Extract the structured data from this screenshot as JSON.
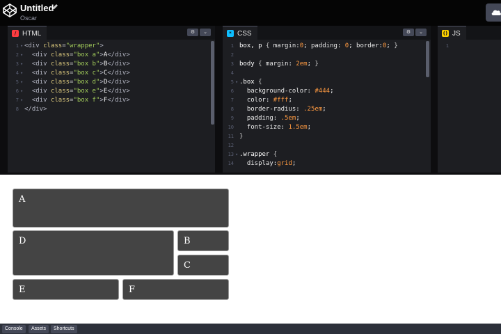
{
  "header": {
    "title": "Untitled",
    "author": "Oscar"
  },
  "editors": {
    "html": {
      "label": "HTML",
      "icon_color": "#ff3c41",
      "lines": [
        {
          "n": "1",
          "text": "<div class=\"wrapper\">"
        },
        {
          "n": "2",
          "text": "  <div class=\"box a\">A</div>"
        },
        {
          "n": "3",
          "text": "  <div class=\"box b\">B</div>"
        },
        {
          "n": "4",
          "text": "  <div class=\"box c\">C</div>"
        },
        {
          "n": "5",
          "text": "  <div class=\"box d\">D</div>"
        },
        {
          "n": "6",
          "text": "  <div class=\"box e\">E</div>"
        },
        {
          "n": "7",
          "text": "  <div class=\"box f\">F</div>"
        },
        {
          "n": "8",
          "text": "</div>"
        }
      ]
    },
    "css": {
      "label": "CSS",
      "icon_color": "#0ebeff",
      "lines": [
        {
          "n": "1",
          "text": "box, p { margin:0; padding: 0; border:0; }"
        },
        {
          "n": "2",
          "text": ""
        },
        {
          "n": "3",
          "text": "body { margin: 2em; }"
        },
        {
          "n": "4",
          "text": ""
        },
        {
          "n": "5",
          "text": ".box {"
        },
        {
          "n": "6",
          "text": "  background-color: #444;"
        },
        {
          "n": "7",
          "text": "  color: #fff;"
        },
        {
          "n": "8",
          "text": "  border-radius: .25em;"
        },
        {
          "n": "9",
          "text": "  padding: .5em;"
        },
        {
          "n": "10",
          "text": "  font-size: 1.5em;"
        },
        {
          "n": "11",
          "text": "}"
        },
        {
          "n": "12",
          "text": ""
        },
        {
          "n": "13",
          "text": ".wrapper {"
        },
        {
          "n": "14",
          "text": "  display:grid;"
        }
      ]
    },
    "js": {
      "label": "JS",
      "icon_color": "#fcd000",
      "lines": [
        {
          "n": "1",
          "text": ""
        }
      ]
    }
  },
  "preview": {
    "boxes": [
      "A",
      "B",
      "C",
      "D",
      "E",
      "F"
    ],
    "box_color": "#444444"
  },
  "footer": {
    "buttons": [
      "Console",
      "Assets",
      "Shortcuts"
    ]
  }
}
